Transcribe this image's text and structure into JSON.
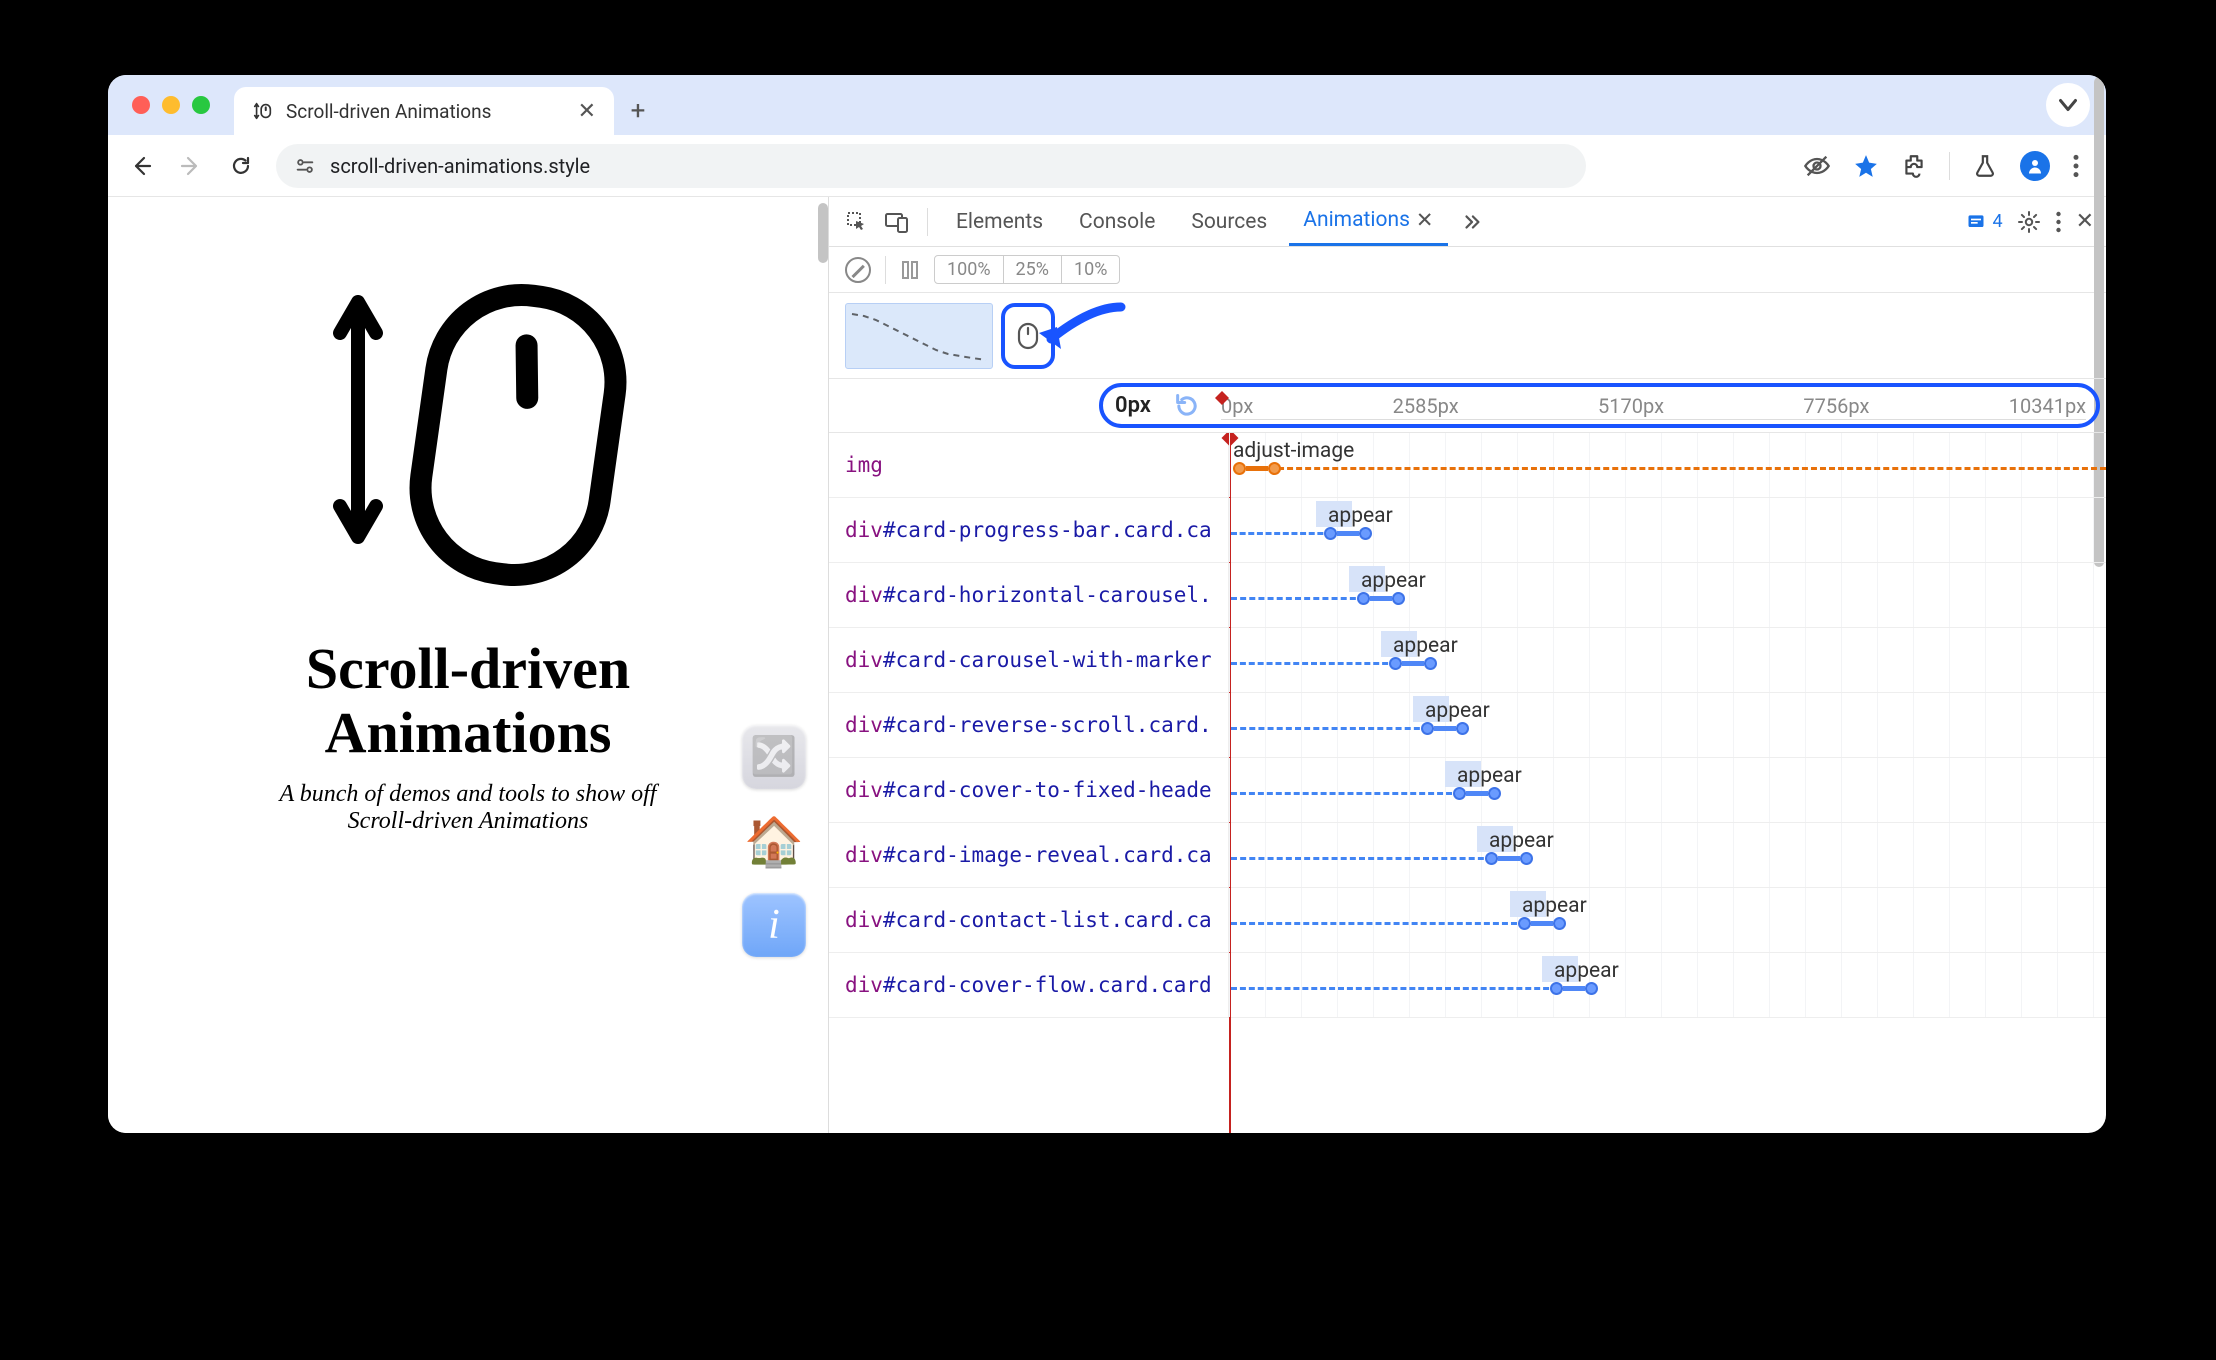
{
  "browser": {
    "tab_title": "Scroll-driven Animations",
    "url": "scroll-driven-animations.style"
  },
  "page": {
    "title_line1": "Scroll-driven",
    "title_line2": "Animations",
    "subtitle_line1": "A bunch of demos and tools to show off",
    "subtitle_line2": "Scroll-driven Animations",
    "home_emoji": "🏠",
    "shuffle_glyph": "🔀"
  },
  "devtools": {
    "tabs": [
      "Elements",
      "Console",
      "Sources",
      "Animations"
    ],
    "active_tab": "Animations",
    "issue_count": "4",
    "speed_options": [
      "100%",
      "25%",
      "10%"
    ],
    "ruler": {
      "current": "0px",
      "ticks": [
        "0px",
        "2585px",
        "5170px",
        "7756px",
        "10341px"
      ]
    },
    "tracks": [
      {
        "tag": "img",
        "idcls": "",
        "anim": "adjust-image",
        "offset": 0,
        "orange": true
      },
      {
        "tag": "div",
        "idcls": "#card-progress-bar.card.ca",
        "anim": "appear",
        "offset": 95
      },
      {
        "tag": "div",
        "idcls": "#card-horizontal-carousel.",
        "anim": "appear",
        "offset": 128
      },
      {
        "tag": "div",
        "idcls": "#card-carousel-with-marker",
        "anim": "appear",
        "offset": 160
      },
      {
        "tag": "div",
        "idcls": "#card-reverse-scroll.card.",
        "anim": "appear",
        "offset": 192
      },
      {
        "tag": "div",
        "idcls": "#card-cover-to-fixed-heade",
        "anim": "appear",
        "offset": 224
      },
      {
        "tag": "div",
        "idcls": "#card-image-reveal.card.ca",
        "anim": "appear",
        "offset": 256
      },
      {
        "tag": "div",
        "idcls": "#card-contact-list.card.ca",
        "anim": "appear",
        "offset": 289
      },
      {
        "tag": "div",
        "idcls": "#card-cover-flow.card.card",
        "anim": "appear",
        "offset": 321
      }
    ]
  }
}
